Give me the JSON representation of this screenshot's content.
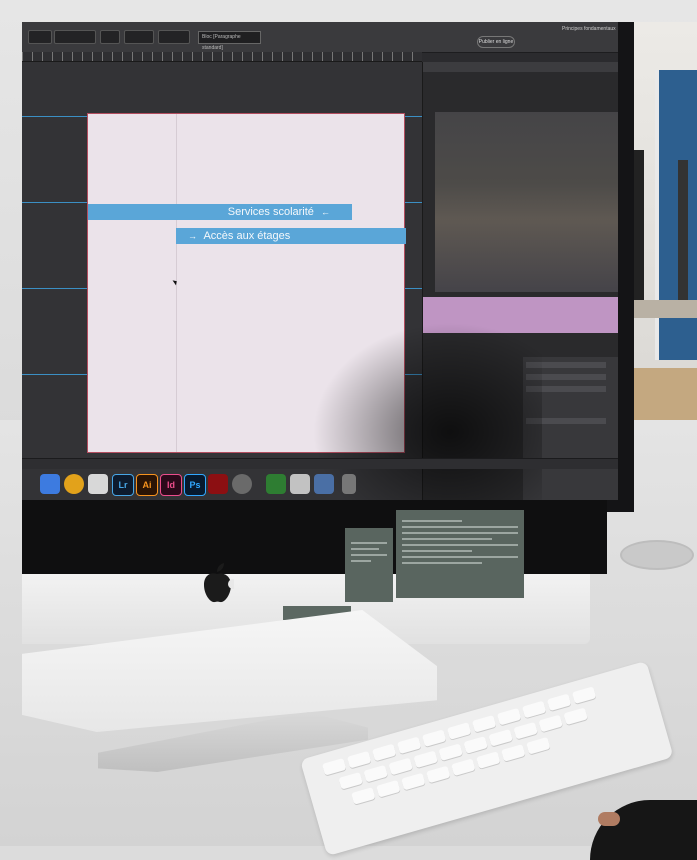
{
  "scene": {
    "description": "Photo of an iMac on a desk showing a layout application with a poster design",
    "accent_color": "#5aa6d8",
    "artboard_background": "#ebe3ea"
  },
  "app": {
    "toolbar_dropdown": "Bloc [Paragraphe standard]",
    "toolbar_button": "Publier en ligne",
    "toolbar_right": "Principes fondamentaux"
  },
  "artboard": {
    "banner_1_text": "Services scolarité",
    "banner_1_arrow": "←",
    "banner_2_arrow": "→",
    "banner_2_text": "Accès aux étages"
  },
  "dock": {
    "icons": [
      {
        "name": "finder-icon",
        "label": "",
        "color": "#3d7be0"
      },
      {
        "name": "chrome-icon",
        "label": "",
        "color": "#e2a21b"
      },
      {
        "name": "notes-icon",
        "label": "",
        "color": "#d8d8d8"
      },
      {
        "name": "lightroom-icon",
        "label": "Lr",
        "color": "#0d1b2e"
      },
      {
        "name": "illustrator-icon",
        "label": "Ai",
        "color": "#2a1405"
      },
      {
        "name": "indesign-icon",
        "label": "Id",
        "color": "#2a0a1a"
      },
      {
        "name": "photoshop-icon",
        "label": "Ps",
        "color": "#071a2e"
      },
      {
        "name": "acrobat-icon",
        "label": "",
        "color": "#8c0f12"
      },
      {
        "name": "utility-icon",
        "label": "",
        "color": "#6a6a6a"
      },
      {
        "name": "charts-icon",
        "label": "",
        "color": "#2e7d32"
      },
      {
        "name": "preview-icon",
        "label": "",
        "color": "#c2c2c2"
      },
      {
        "name": "photos-icon",
        "label": "",
        "color": "#4a6fa5"
      },
      {
        "name": "trash-icon",
        "label": "",
        "color": "#777777"
      }
    ]
  }
}
